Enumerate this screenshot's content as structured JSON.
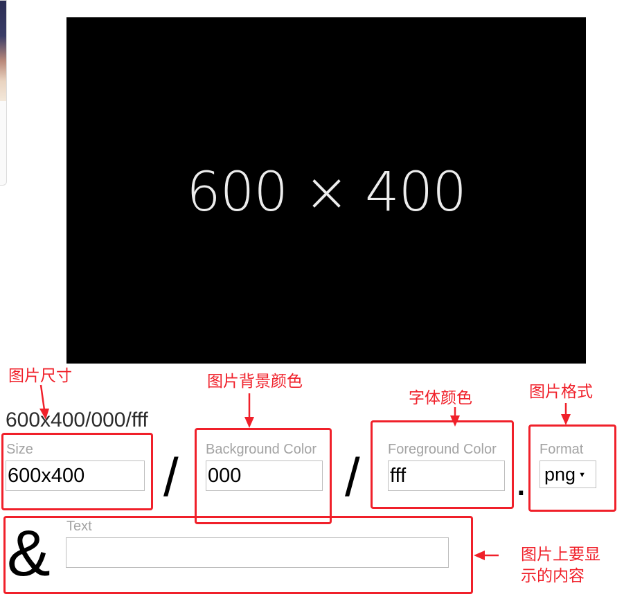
{
  "preview": {
    "text": "600 × 400",
    "background": "#000000",
    "foreground": "#ececec"
  },
  "url_display": "600x400/000/fff",
  "fields": {
    "size": {
      "label": "Size",
      "value": "600x400"
    },
    "background": {
      "label": "Background Color",
      "value": "000"
    },
    "foreground": {
      "label": "Foreground Color",
      "value": "fff"
    },
    "format": {
      "label": "Format",
      "value": "png"
    },
    "text": {
      "label": "Text",
      "value": ""
    }
  },
  "separators": {
    "slash": "/",
    "dot": ".",
    "amp": "&"
  },
  "annotations": {
    "size": "图片尺寸",
    "background": "图片背景颜色",
    "foreground": "字体颜色",
    "format": "图片格式",
    "text_line1": "图片上要显",
    "text_line2": "示的内容"
  },
  "colors": {
    "annotation": "#f0202a",
    "label_gray": "#a3a3a3",
    "border": "#bdbdbd"
  }
}
